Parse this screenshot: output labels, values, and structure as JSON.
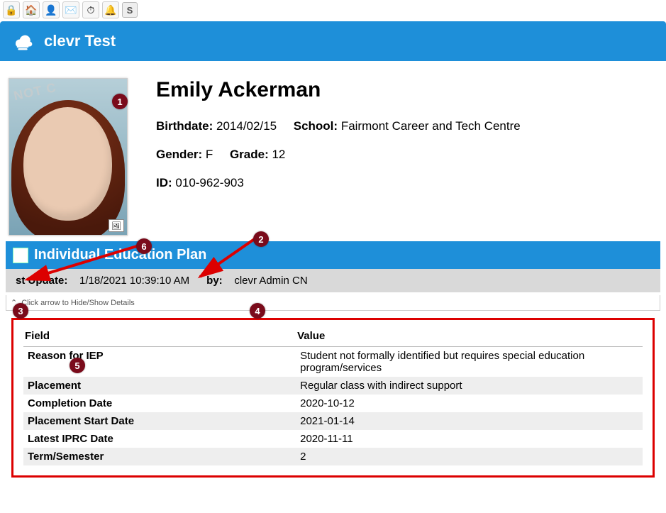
{
  "toolbar": {
    "icons": [
      {
        "name": "lock-icon",
        "glyph": "🔒"
      },
      {
        "name": "home-icon",
        "glyph": "🏠"
      },
      {
        "name": "user-lock-icon",
        "glyph": "👤"
      },
      {
        "name": "mail-icon",
        "glyph": "✉️"
      },
      {
        "name": "dashboard-icon",
        "glyph": "⏱"
      },
      {
        "name": "bell-icon",
        "glyph": "🔔"
      }
    ],
    "s_button": "S"
  },
  "header": {
    "title": "clevr Test"
  },
  "student": {
    "name": "Emily Ackerman",
    "birthdate_label": "Birthdate:",
    "birthdate": "2014/02/15",
    "school_label": "School:",
    "school": "Fairmont Career and Tech Centre",
    "gender_label": "Gender:",
    "gender": "F",
    "grade_label": "Grade:",
    "grade": "12",
    "id_label": "ID:",
    "id": "010-962-903",
    "photo_watermark": "NOT C"
  },
  "section": {
    "title": "Individual Education Plan"
  },
  "update": {
    "last_update_label": "st Update:",
    "last_update_value": "1/18/2021 10:39:10 AM",
    "by_label": "by:",
    "by_value": "clevr Admin CN"
  },
  "hideshow_text": "Click arrow to Hide/Show Details",
  "table": {
    "head_field": "Field",
    "head_value": "Value",
    "rows": [
      {
        "field": "Reason for IEP",
        "value": "Student not formally identified but requires special education program/services"
      },
      {
        "field": "Placement",
        "value": "Regular class with indirect support"
      },
      {
        "field": "Completion Date",
        "value": "2020-10-12"
      },
      {
        "field": "Placement Start Date",
        "value": "2021-01-14"
      },
      {
        "field": "Latest IPRC Date",
        "value": "2020-11-11"
      },
      {
        "field": "Term/Semester",
        "value": "2"
      }
    ]
  },
  "callouts": {
    "1": "1",
    "2": "2",
    "3": "3",
    "4": "4",
    "5": "5",
    "6": "6"
  }
}
